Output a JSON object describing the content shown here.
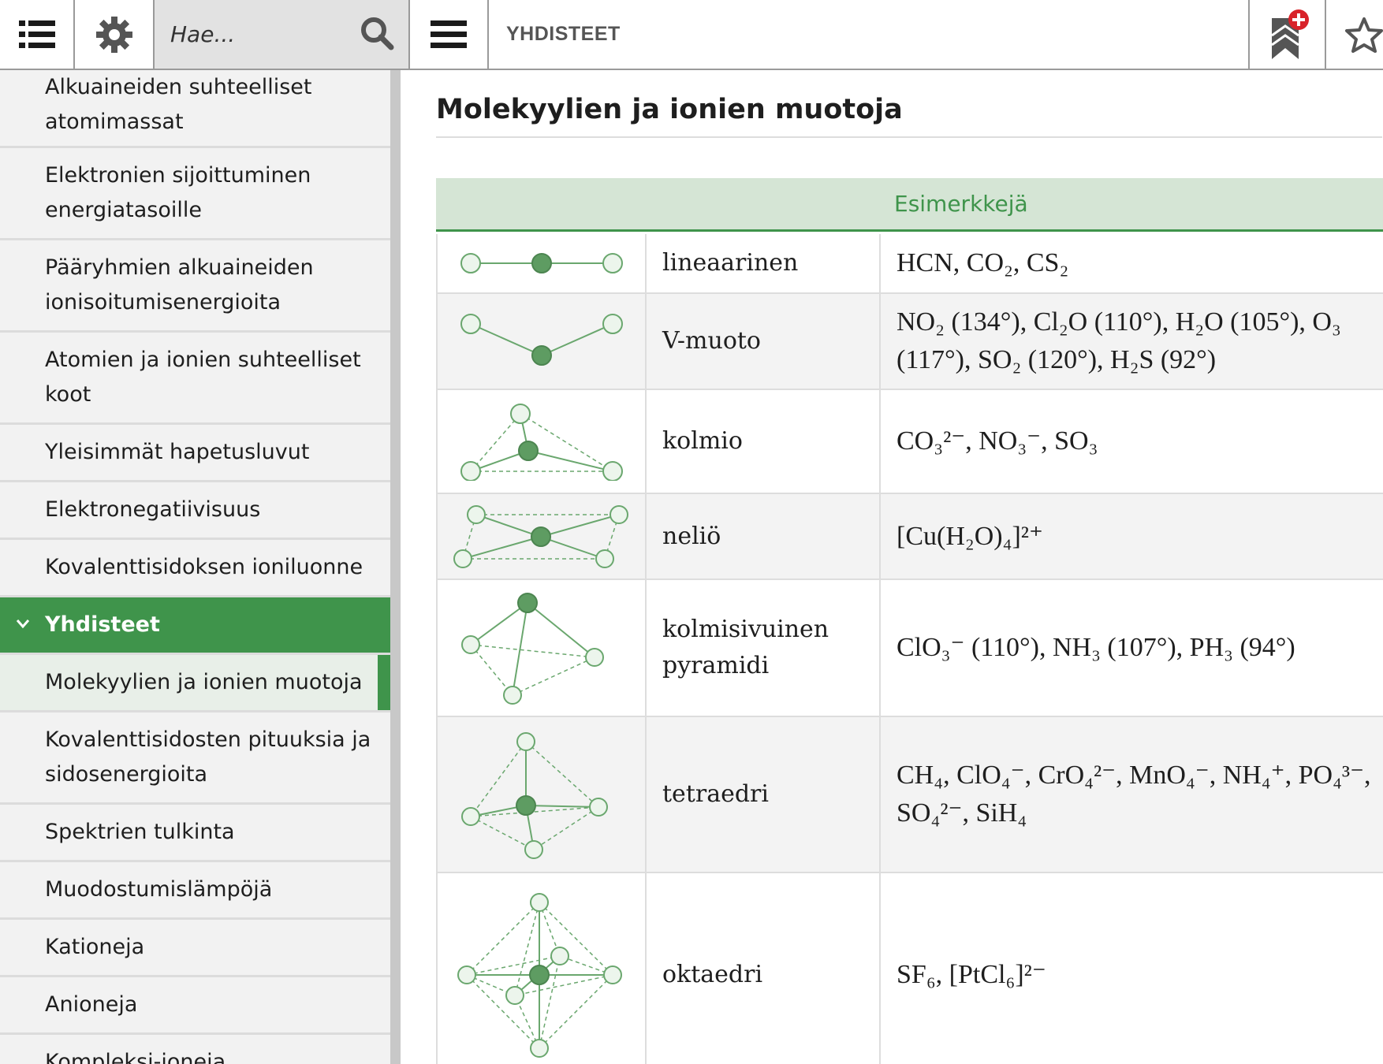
{
  "toolbar": {
    "search_placeholder": "Hae...",
    "title": "YHDISTEET",
    "icons": [
      "list-menu-icon",
      "gear-icon",
      "search-icon",
      "hamburger-icon",
      "bookmark-add-icon",
      "star-icon"
    ]
  },
  "colors": {
    "accent_green": "#3f944b",
    "header_green_bg": "#d5e5d5",
    "bookmark_badge_red": "#d8232a"
  },
  "sidebar": {
    "items": [
      {
        "label": "Alkuaineiden suhteelliset atomimassat"
      },
      {
        "label": "Elektronien sijoittuminen energiatasoille"
      },
      {
        "label": "Pääryhmien alkuaineiden ionisoitumisenergioita"
      },
      {
        "label": "Atomien ja ionien suhteelliset koot"
      },
      {
        "label": "Yleisimmät hapetusluvut"
      },
      {
        "label": "Elektronegatiivisuus"
      },
      {
        "label": "Kovalenttisidoksen ioniluonne"
      },
      {
        "label": "Yhdisteet",
        "state": "expanded"
      },
      {
        "label": "Molekyylien ja ionien muotoja",
        "state": "current"
      },
      {
        "label": "Kovalenttisidosten pituuksia ja sidosenergioita"
      },
      {
        "label": "Spektrien tulkinta"
      },
      {
        "label": "Muodostumislämpöjä"
      },
      {
        "label": "Kationeja"
      },
      {
        "label": "Anioneja"
      },
      {
        "label": "Kompleksi-ioneja"
      }
    ]
  },
  "content": {
    "title": "Molekyylien ja ionien muotoja",
    "table_header": "Esimerkkejä",
    "rows": [
      {
        "shape": "lineaarinen",
        "examples": "HCN, CO₂, CS₂"
      },
      {
        "shape": "V-muoto",
        "examples": "NO₂ (134°), Cl₂O (110°), H₂O (105°), O₃ (117°), SO₂ (120°), H₂S (92°)"
      },
      {
        "shape": "kolmio",
        "examples": "CO₃²⁻, NO₃⁻, SO₃"
      },
      {
        "shape": "neliö",
        "examples": "[Cu(H₂O)₄]²⁺"
      },
      {
        "shape": "kolmisivuinen pyramidi",
        "examples": "ClO₃⁻ (110°), NH₃ (107°), PH₃ (94°)"
      },
      {
        "shape": "tetraedri",
        "examples": "CH₄, ClO₄⁻, CrO₄²⁻, MnO₄⁻, NH₄⁺, PO₄³⁻, SO₄²⁻, SiH₄"
      },
      {
        "shape": "oktaedri",
        "examples": "SF₆, [PtCl₆]²⁻"
      }
    ]
  }
}
